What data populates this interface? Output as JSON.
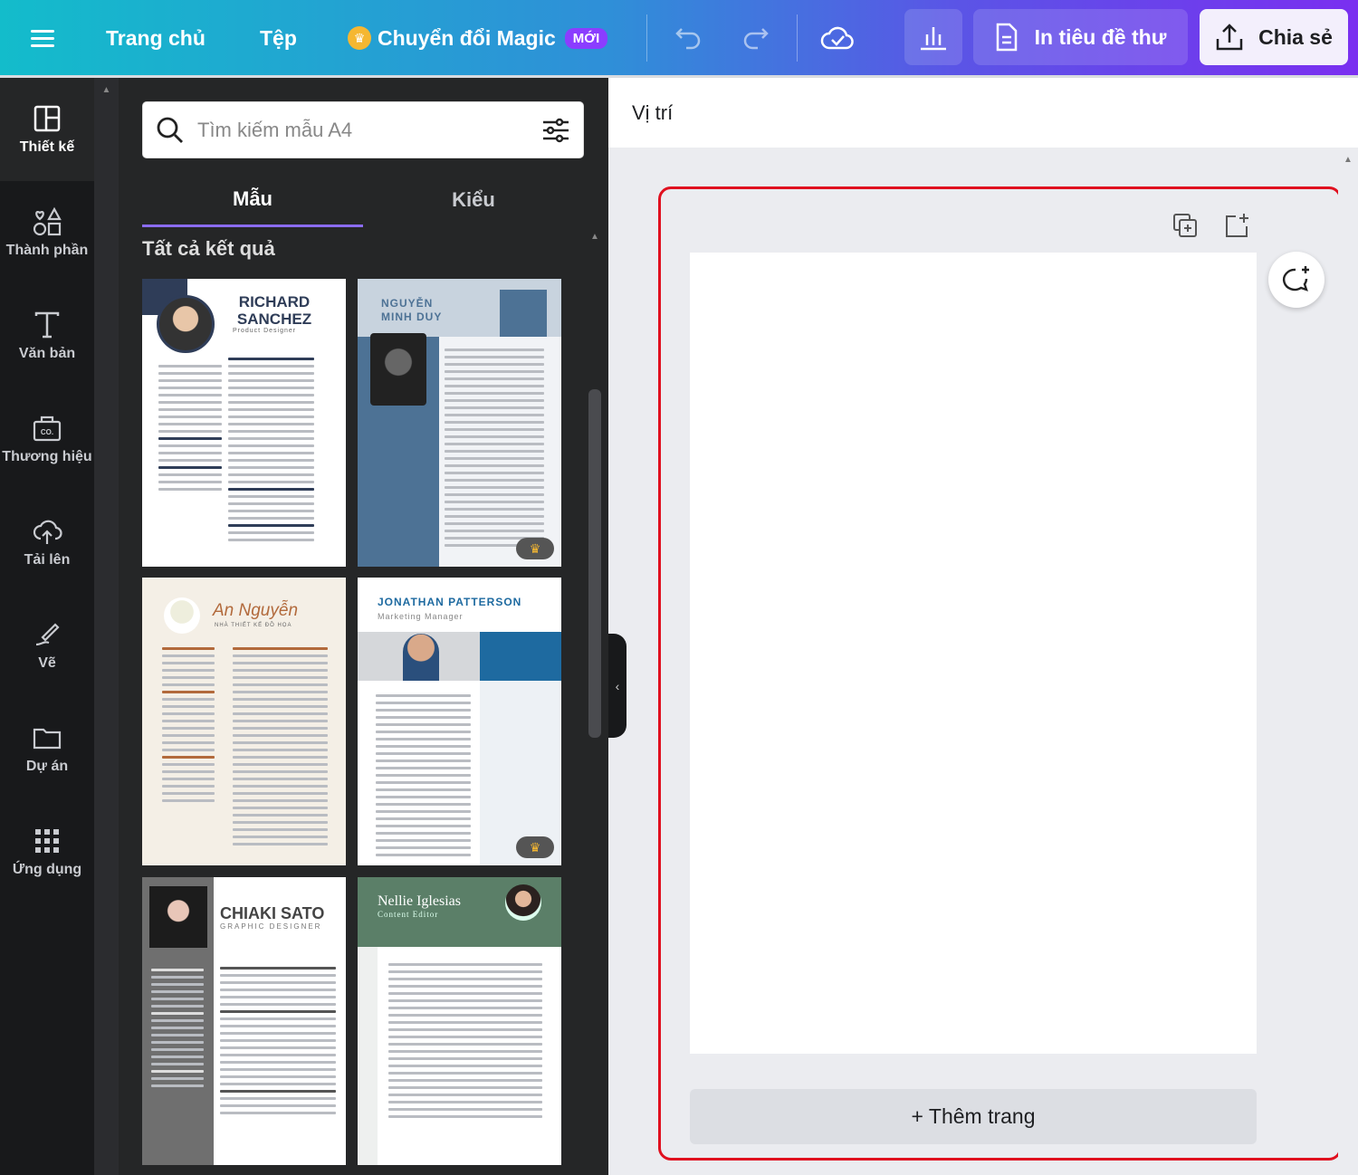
{
  "topbar": {
    "home": "Trang chủ",
    "file": "Tệp",
    "magic": "Chuyển đổi Magic",
    "magic_badge": "MỚI",
    "print": "In tiêu đề thư",
    "share": "Chia sẻ",
    "colors": {
      "gradient_start": "#13bccb",
      "gradient_end": "#7a2ff0"
    }
  },
  "rail": {
    "items": [
      {
        "label": "Thiết kế",
        "icon": "layout-icon"
      },
      {
        "label": "Thành phần",
        "icon": "shapes-icon"
      },
      {
        "label": "Văn bản",
        "icon": "text-icon"
      },
      {
        "label": "Thương hiệu",
        "icon": "brand-icon"
      },
      {
        "label": "Tải lên",
        "icon": "cloud-upload-icon"
      },
      {
        "label": "Vẽ",
        "icon": "draw-icon"
      },
      {
        "label": "Dự án",
        "icon": "folder-icon"
      },
      {
        "label": "Ứng dụng",
        "icon": "apps-icon"
      }
    ]
  },
  "panel": {
    "search_placeholder": "Tìm kiếm mẫu A4",
    "tabs": [
      "Mẫu",
      "Kiểu"
    ],
    "results_label": "Tất cả kết quả",
    "templates": [
      {
        "name": "RICHARD SANCHEZ",
        "subtitle": "Product Designer",
        "premium": false
      },
      {
        "name": "NGUYỄN MINH DUY",
        "subtitle": "",
        "premium": true
      },
      {
        "name": "An Nguyễn",
        "subtitle": "NHÀ THIẾT KẾ ĐỒ HỌA",
        "premium": false
      },
      {
        "name": "JONATHAN PATTERSON",
        "subtitle": "Marketing Manager",
        "premium": true
      },
      {
        "name": "CHIAKI SATO",
        "subtitle": "GRAPHIC DESIGNER",
        "premium": false
      },
      {
        "name": "Nellie Iglesias",
        "subtitle": "Content Editor",
        "premium": false
      }
    ]
  },
  "editor": {
    "header": "Vị trí",
    "add_page": "+ Thêm trang",
    "highlight_color": "#e0101f"
  }
}
